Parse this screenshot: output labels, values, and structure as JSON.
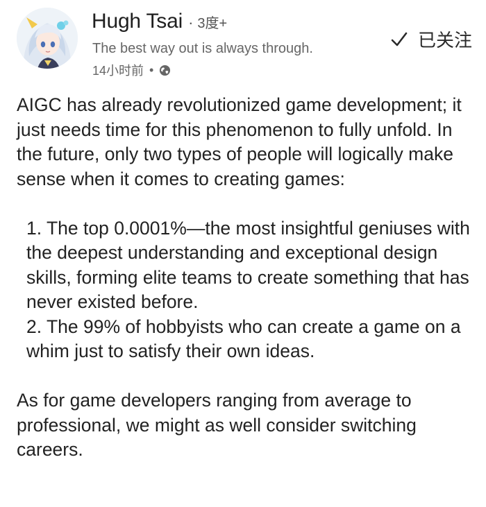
{
  "author": {
    "name": "Hugh Tsai",
    "separator": "·",
    "degree": "3度+",
    "tagline": "The best way out is always through.",
    "time": "14小时前",
    "meta_separator": "•",
    "visibility_icon": "globe-icon",
    "avatar_icon": "anime-avatar-icon"
  },
  "follow": {
    "icon": "check-icon",
    "label": "已关注"
  },
  "post": {
    "para1": "AIGC has already revolutionized game development; it just needs time for this phenomenon to fully unfold. In the future, only two types of people will logically make sense when it comes to creating games:",
    "item1": "1. The top 0.0001%—the most insightful geniuses with the deepest understanding and exceptional design skills, forming elite teams to create something that has never existed before.",
    "item2": "2. The 99% of hobbyists who can create a game on a whim just to satisfy their own ideas.",
    "para2": "As for game developers ranging from average to professional, we might as well consider switching careers."
  },
  "colors": {
    "text": "#222222",
    "secondary": "#666666",
    "background": "#ffffff"
  }
}
